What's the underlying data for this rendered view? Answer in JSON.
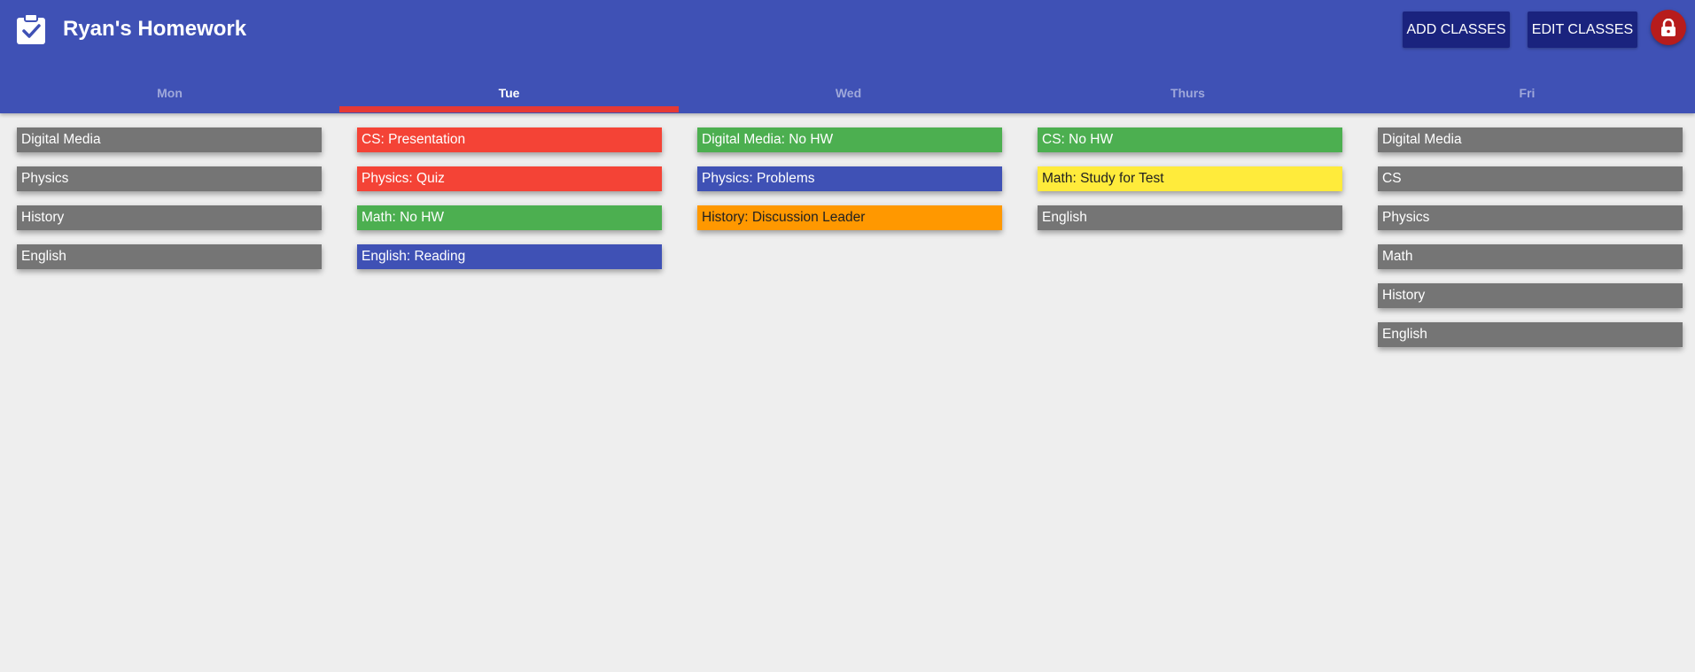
{
  "app": {
    "title": "Ryan's Homework",
    "icon": "clipboard-check-icon"
  },
  "header": {
    "add_classes_label": "ADD CLASSES",
    "edit_classes_label": "EDIT CLASSES",
    "lock_icon": "lock-icon",
    "colors": {
      "bar": "#3f51b5",
      "button": "#1a237e",
      "lock": "#b71c1c",
      "tab_indicator": "#e53935"
    }
  },
  "tabs": [
    {
      "label": "Mon",
      "active": false
    },
    {
      "label": "Tue",
      "active": true
    },
    {
      "label": "Wed",
      "active": false
    },
    {
      "label": "Thurs",
      "active": false
    },
    {
      "label": "Fri",
      "active": false
    }
  ],
  "days": [
    {
      "day": "Mon",
      "items": [
        {
          "label": "Digital Media",
          "status": "none",
          "color": "#757575",
          "text_color": "#ffffff"
        },
        {
          "label": "Physics",
          "status": "none",
          "color": "#757575",
          "text_color": "#ffffff"
        },
        {
          "label": "History",
          "status": "none",
          "color": "#757575",
          "text_color": "#ffffff"
        },
        {
          "label": "English",
          "status": "none",
          "color": "#757575",
          "text_color": "#ffffff"
        }
      ]
    },
    {
      "day": "Tue",
      "items": [
        {
          "label": "CS: Presentation",
          "status": "urgent",
          "color": "#f44336",
          "text_color": "#ffffff"
        },
        {
          "label": "Physics: Quiz",
          "status": "urgent",
          "color": "#f44336",
          "text_color": "#ffffff"
        },
        {
          "label": "Math: No HW",
          "status": "done",
          "color": "#4caf50",
          "text_color": "#ffffff"
        },
        {
          "label": "English: Reading",
          "status": "assigned",
          "color": "#3f51b5",
          "text_color": "#ffffff"
        }
      ]
    },
    {
      "day": "Wed",
      "items": [
        {
          "label": "Digital Media: No HW",
          "status": "done",
          "color": "#4caf50",
          "text_color": "#ffffff"
        },
        {
          "label": "Physics: Problems",
          "status": "assigned",
          "color": "#3f51b5",
          "text_color": "#ffffff"
        },
        {
          "label": "History: Discussion Leader",
          "status": "important",
          "color": "#ff9800",
          "text_color": "#212121"
        }
      ]
    },
    {
      "day": "Thurs",
      "items": [
        {
          "label": "CS: No HW",
          "status": "done",
          "color": "#4caf50",
          "text_color": "#ffffff"
        },
        {
          "label": "Math: Study for Test",
          "status": "test",
          "color": "#ffeb3b",
          "text_color": "#212121"
        },
        {
          "label": "English",
          "status": "none",
          "color": "#757575",
          "text_color": "#ffffff"
        }
      ]
    },
    {
      "day": "Fri",
      "items": [
        {
          "label": "Digital Media",
          "status": "none",
          "color": "#757575",
          "text_color": "#ffffff"
        },
        {
          "label": "CS",
          "status": "none",
          "color": "#757575",
          "text_color": "#ffffff"
        },
        {
          "label": "Physics",
          "status": "none",
          "color": "#757575",
          "text_color": "#ffffff"
        },
        {
          "label": "Math",
          "status": "none",
          "color": "#757575",
          "text_color": "#ffffff"
        },
        {
          "label": "History",
          "status": "none",
          "color": "#757575",
          "text_color": "#ffffff"
        },
        {
          "label": "English",
          "status": "none",
          "color": "#757575",
          "text_color": "#ffffff"
        }
      ]
    }
  ]
}
